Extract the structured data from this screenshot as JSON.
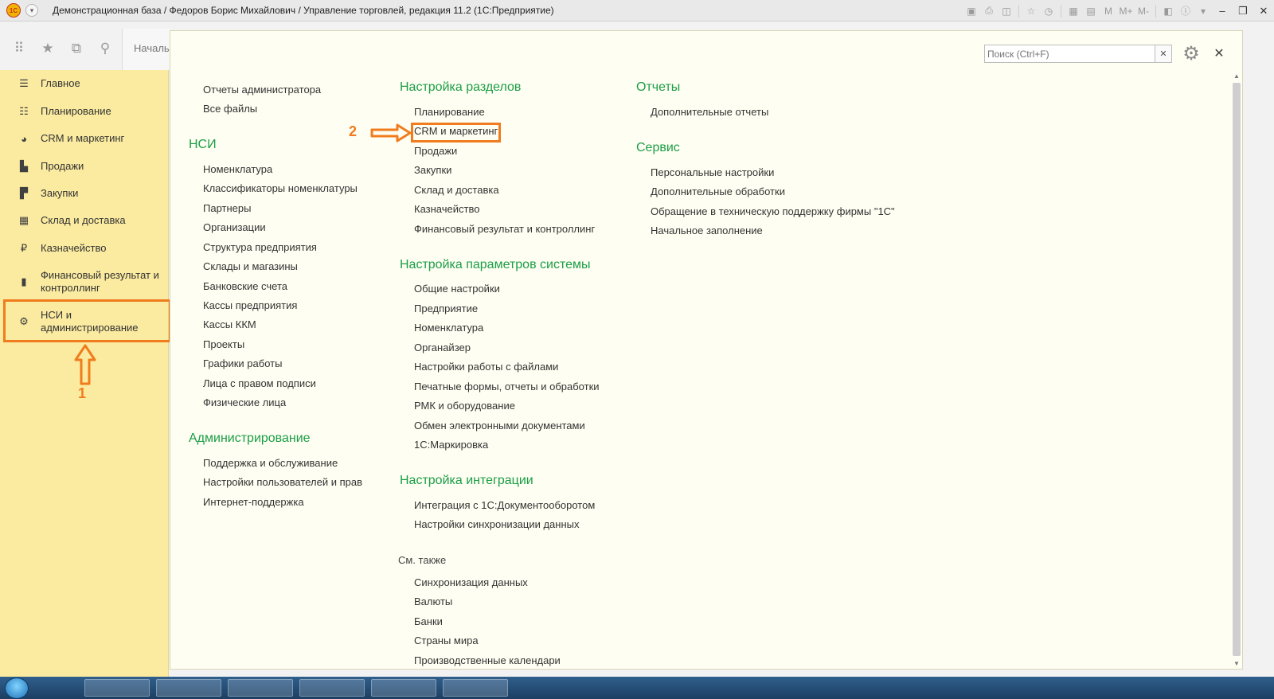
{
  "window": {
    "title": "Демонстрационная база / Федоров Борис Михайлович / Управление торговлей, редакция 11.2  (1С:Предприятие)",
    "logo": "1С",
    "toolbar_text": [
      "M",
      "M+",
      "M-"
    ]
  },
  "tabs": {
    "home_label": "Начальная страница"
  },
  "sidebar": {
    "items": [
      {
        "label": "Главное",
        "icon": "menu-icon"
      },
      {
        "label": "Планирование",
        "icon": "planning-icon"
      },
      {
        "label": "CRM и маркетинг",
        "icon": "pie-chart-icon"
      },
      {
        "label": "Продажи",
        "icon": "shopping-bag-icon"
      },
      {
        "label": "Закупки",
        "icon": "cart-icon"
      },
      {
        "label": "Склад и доставка",
        "icon": "warehouse-icon"
      },
      {
        "label": "Казначейство",
        "icon": "ruble-icon"
      },
      {
        "label": "Финансовый результат и контроллинг",
        "icon": "bar-chart-icon"
      },
      {
        "label": "НСИ и администрирование",
        "icon": "gear-icon",
        "selected": true
      }
    ]
  },
  "content": {
    "search_placeholder": "Поиск (Ctrl+F)",
    "column1": {
      "top_links": [
        "Отчеты администратора",
        "Все файлы"
      ],
      "nsi_title": "НСИ",
      "nsi_links": [
        "Номенклатура",
        "Классификаторы номенклатуры",
        "Партнеры",
        "Организации",
        "Структура предприятия",
        "Склады и магазины",
        "Банковские счета",
        "Кассы предприятия",
        "Кассы ККМ",
        "Проекты",
        "Графики работы",
        "Лица с правом подписи",
        "Физические лица"
      ],
      "admin_title": "Администрирование",
      "admin_links": [
        "Поддержка и обслуживание",
        "Настройки пользователей и прав",
        "Интернет-поддержка"
      ]
    },
    "column2": {
      "sections_title": "Настройка разделов",
      "sections_links": [
        "Планирование",
        "CRM и маркетинг",
        "Продажи",
        "Закупки",
        "Склад и доставка",
        "Казначейство",
        "Финансовый результат и контроллинг"
      ],
      "system_title": "Настройка параметров системы",
      "system_links": [
        "Общие настройки",
        "Предприятие",
        "Номенклатура",
        "Органайзер",
        "Настройки работы с файлами",
        "Печатные формы, отчеты и обработки",
        "РМК и оборудование",
        "Обмен электронными документами",
        "1С:Маркировка"
      ],
      "integration_title": "Настройка интеграции",
      "integration_links": [
        "Интеграция с 1С:Документооборотом",
        "Настройки синхронизации данных"
      ],
      "see_also_title": "См. также",
      "see_also_links": [
        "Синхронизация данных",
        "Валюты",
        "Банки",
        "Страны мира",
        "Производственные календари"
      ]
    },
    "column3": {
      "reports_title": "Отчеты",
      "reports_links": [
        "Дополнительные отчеты"
      ],
      "service_title": "Сервис",
      "service_links": [
        "Персональные настройки",
        "Дополнительные обработки",
        "Обращение в техническую поддержку фирмы \"1С\"",
        "Начальное заполнение"
      ]
    }
  },
  "annotations": {
    "step1": "1",
    "step2": "2",
    "accent_color": "#f07c1e"
  },
  "colors": {
    "section_title": "#1a9e46",
    "sidebar_bg": "#fbeba0",
    "content_bg": "#fffef2"
  }
}
